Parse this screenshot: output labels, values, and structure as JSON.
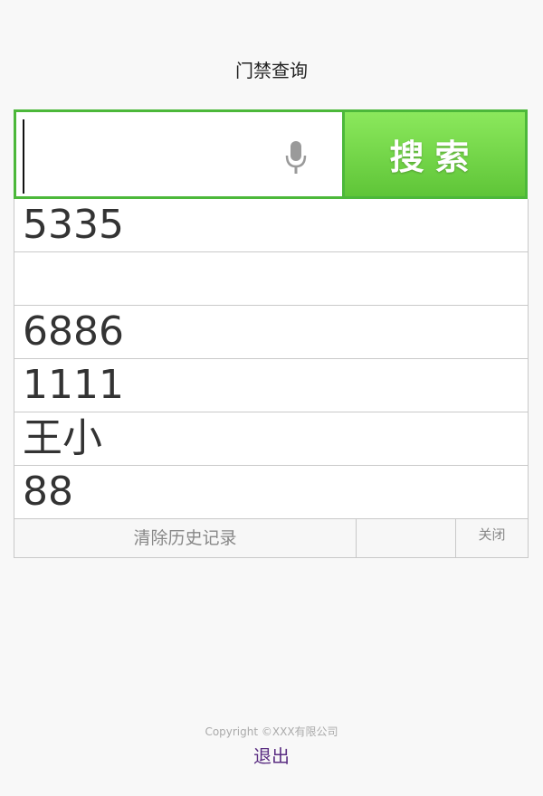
{
  "page": {
    "title": "门禁查询"
  },
  "search": {
    "value": "",
    "button_label": "搜索",
    "mic_icon": "microphone-icon"
  },
  "history": {
    "items": [
      "5335",
      "",
      "6886",
      "1111",
      "王小",
      "88"
    ],
    "clear_label": "清除历史记录",
    "close_label": "关闭"
  },
  "footer": {
    "copyright": "Copyright ©XXX有限公司",
    "logout_label": "退出"
  },
  "colors": {
    "accent": "#4cb83a",
    "button_top": "#8be85c",
    "button_bottom": "#5fc538",
    "link": "#5a2d82"
  }
}
